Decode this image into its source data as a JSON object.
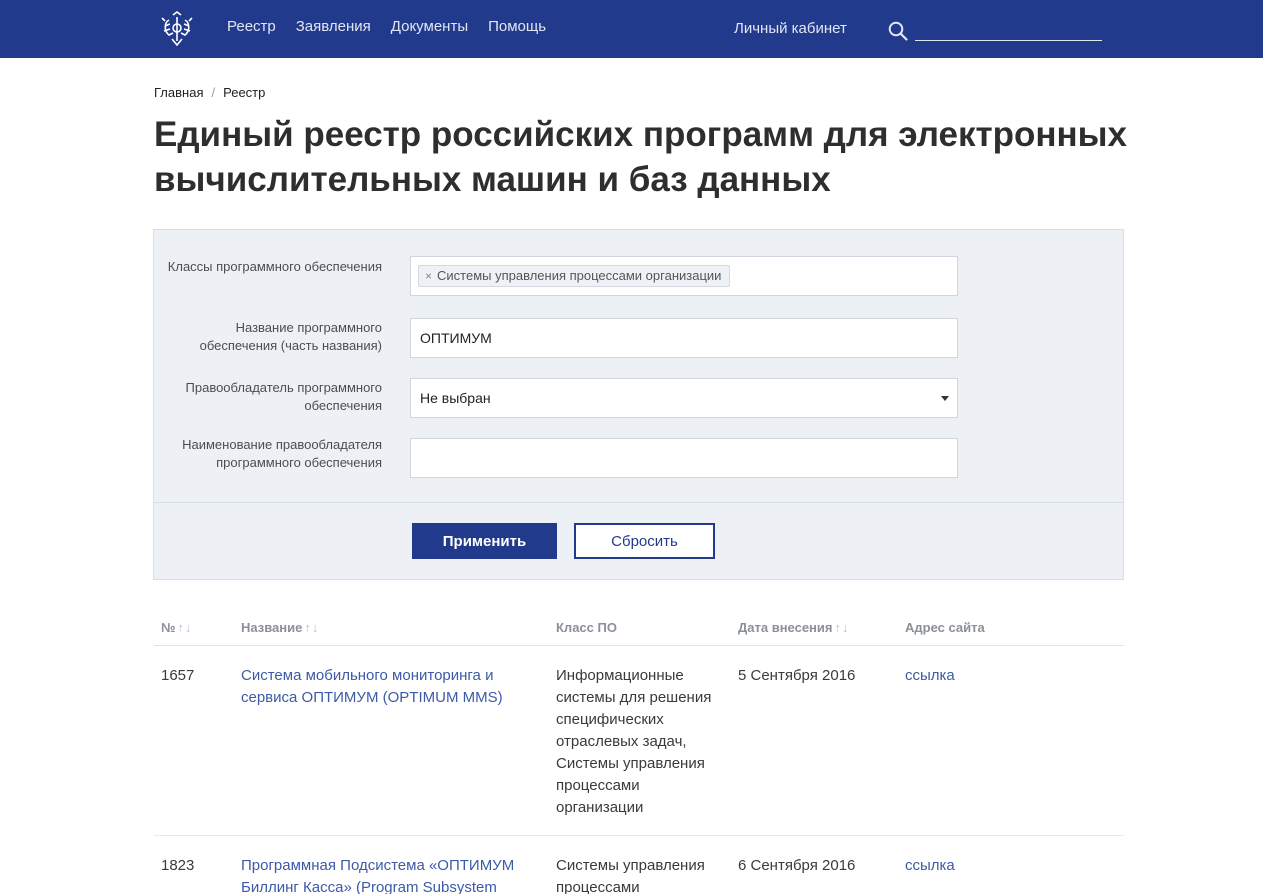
{
  "header": {
    "nav": [
      "Реестр",
      "Заявления",
      "Документы",
      "Помощь"
    ],
    "cabinet_label": "Личный кабинет",
    "search_placeholder": ""
  },
  "breadcrumb": {
    "home": "Главная",
    "separator": "/",
    "current": "Реестр"
  },
  "page_title": "Единый реестр российских программ для электронных вычислительных машин и баз данных",
  "filter": {
    "classes_label": "Классы программного обеспечения",
    "classes_tag": "Системы управления процессами организации",
    "classes_tag_remove": "×",
    "name_label": "Название программного обеспечения (часть названия)",
    "name_value": "ОПТИМУМ",
    "owner_label": "Правообладатель программного обеспечения",
    "owner_selected": "Не выбран",
    "owner_name_label": "Наименование правообладателя программного обеспечения",
    "owner_name_value": "",
    "apply_label": "Применить",
    "reset_label": "Сбросить"
  },
  "table": {
    "columns": {
      "number": "№",
      "name": "Название",
      "class": "Класс ПО",
      "date": "Дата внесения",
      "site": "Адрес сайта"
    },
    "sort_arrows": "↑↓",
    "rows": [
      {
        "number": "1657",
        "name": "Система мобильного мониторинга и сервиса ОПТИМУМ (OPTIMUM MMS)",
        "class": "Информационные системы для решения специфических отраслевых задач, Системы управления процессами организации",
        "date": "5 Сентября 2016",
        "site": "ссылка"
      },
      {
        "number": "1823",
        "name": "Программная Подсистема «ОПТИМУМ Биллинг Касса» (Program Subsystem",
        "class": "Системы управления процессами",
        "date": "6 Сентября 2016",
        "site": "ссылка"
      }
    ]
  },
  "colors": {
    "header_bg": "#223a8c",
    "link": "#3d5aa8",
    "panel_bg": "#edf1f6"
  }
}
